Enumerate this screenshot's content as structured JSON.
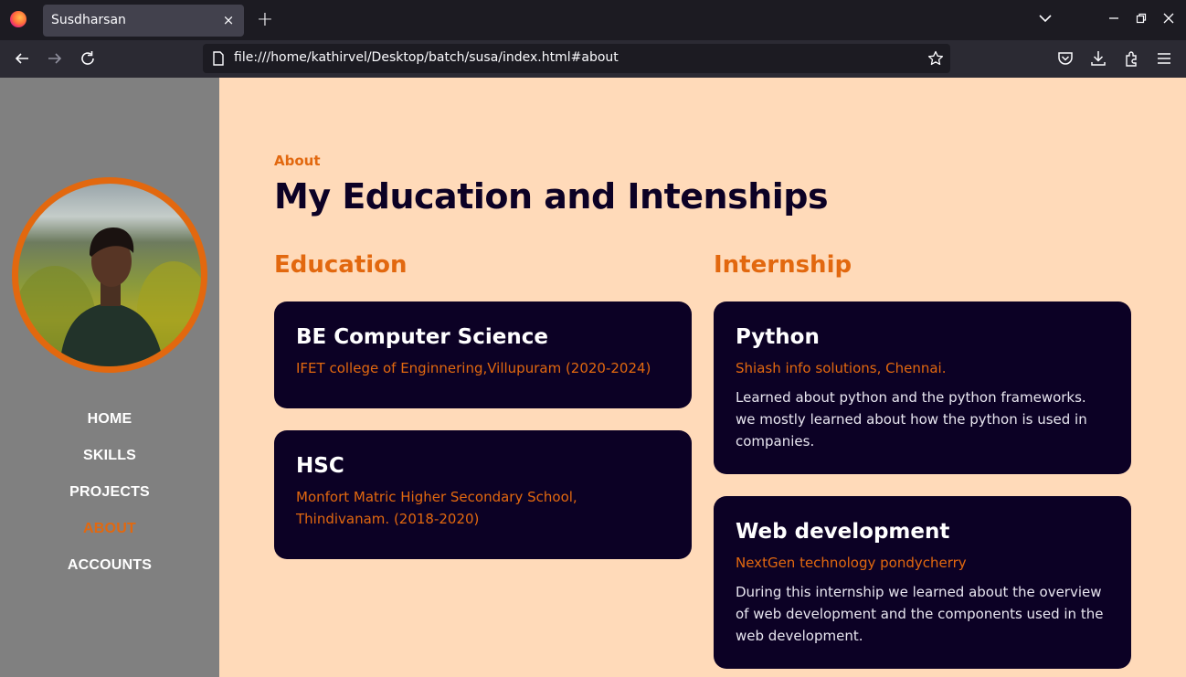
{
  "browser": {
    "tab_title": "Susdharsan",
    "tab_close": "×",
    "new_tab": "+",
    "url": "file:///home/kathirvel/Desktop/batch/susa/index.html#about"
  },
  "sidebar": {
    "menu": [
      "HOME",
      "SKILLS",
      "PROJECTS",
      "ABOUT",
      "ACCOUNTS"
    ],
    "active": "ABOUT"
  },
  "about": {
    "label": "About",
    "heading": "My Education and Intenships",
    "education_title": "Education",
    "internship_title": "Internship",
    "education": [
      {
        "title": "BE Computer Science",
        "subtitle": "IFET college of Enginnering,Villupuram (2020-2024)"
      },
      {
        "title": "HSC",
        "subtitle": "Monfort Matric Higher Secondary School, Thindivanam. (2018-2020)"
      }
    ],
    "internships": [
      {
        "title": "Python",
        "subtitle": "Shiash info solutions, Chennai.",
        "description": "Learned about python and the python frameworks. we mostly learned about how the python is used in companies."
      },
      {
        "title": "Web development",
        "subtitle": "NextGen technology pondycherry",
        "description": "During this internship we learned about the overview of web development and the components used in the web development."
      }
    ]
  },
  "colors": {
    "accent": "#e2680f",
    "card_bg": "#0c0125",
    "page_bg": "#ffdab9",
    "sidebar_bg": "#808080"
  }
}
